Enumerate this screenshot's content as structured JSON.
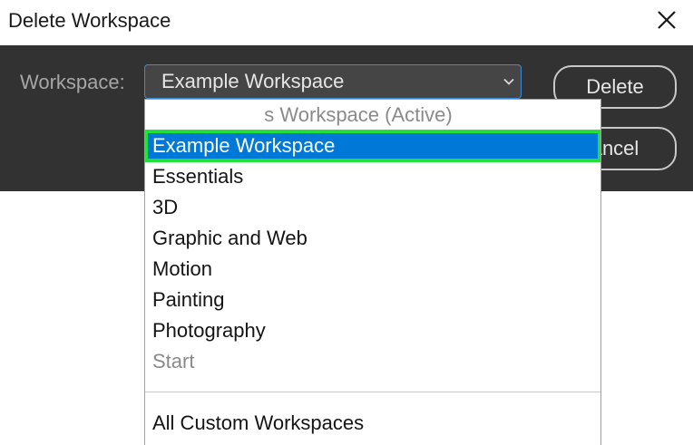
{
  "window": {
    "title": "Delete Workspace",
    "close_icon": "close-icon"
  },
  "form": {
    "workspace_label": "Workspace:",
    "selected_value": "Example Workspace",
    "chevron_icon": "chevron-down-icon"
  },
  "buttons": {
    "delete_label": "Delete",
    "cancel_label": "ancel"
  },
  "dropdown": {
    "active_item_visible_text": "s Workspace (Active)",
    "items": [
      {
        "label": "Example Workspace",
        "state": "selected"
      },
      {
        "label": "Essentials",
        "state": "enabled"
      },
      {
        "label": "3D",
        "state": "enabled"
      },
      {
        "label": "Graphic and Web",
        "state": "enabled"
      },
      {
        "label": "Motion",
        "state": "enabled"
      },
      {
        "label": "Painting",
        "state": "enabled"
      },
      {
        "label": "Photography",
        "state": "enabled"
      },
      {
        "label": "Start",
        "state": "disabled"
      }
    ],
    "footer_item": "All Custom Workspaces"
  },
  "colors": {
    "panel_bg": "#323232",
    "selection_bg": "#0078d7",
    "highlight_outline": "#22e03a",
    "select_border": "#3c8bd9"
  }
}
